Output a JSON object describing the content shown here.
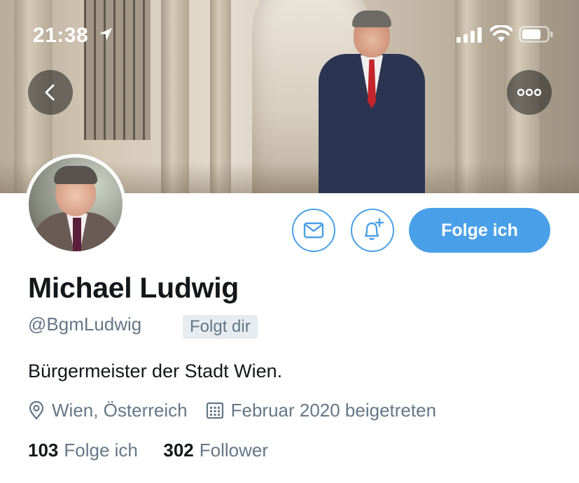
{
  "status_bar": {
    "time": "21:38"
  },
  "header": {
    "back_icon": "chevron-left-icon",
    "more_icon": "more-horizontal-icon"
  },
  "profile": {
    "name": "Michael Ludwig",
    "handle": "@BgmLudwig",
    "follows_you_badge": "Folgt dir",
    "bio": "Bürgermeister der Stadt Wien.",
    "location": "Wien, Österreich",
    "joined": "Februar 2020 beigetreten",
    "following_count": "103",
    "following_label": "Folge ich",
    "followers_count": "302",
    "followers_label": "Follower"
  },
  "actions": {
    "message_icon": "mail-icon",
    "notify_icon": "bell-plus-icon",
    "follow_label": "Folge ich"
  },
  "colors": {
    "accent": "#4aa0e8",
    "text_primary": "#14171a",
    "text_secondary": "#657786",
    "badge_bg": "#e6ecf0"
  }
}
